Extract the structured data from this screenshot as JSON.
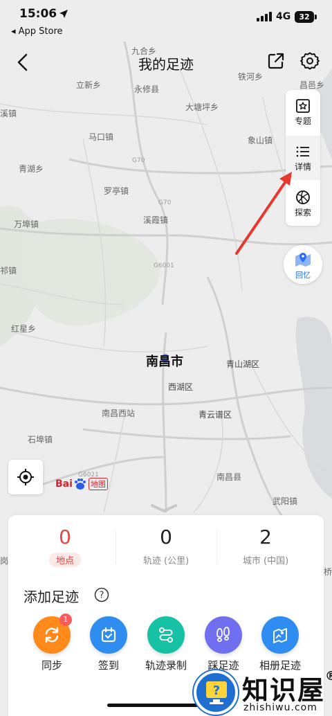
{
  "status_bar": {
    "time": "15:06",
    "back_app": "◂ App Store",
    "network": "4G",
    "battery": "32"
  },
  "nav": {
    "title": "我的足迹"
  },
  "sidebar": {
    "items": [
      {
        "label": "专题",
        "icon": "topic-icon"
      },
      {
        "label": "详情",
        "icon": "list-icon"
      },
      {
        "label": "探索",
        "icon": "explore-icon"
      }
    ]
  },
  "memory_button": {
    "label": "回忆"
  },
  "map": {
    "city": "南昌市",
    "labels": [
      "九合乡",
      "立新乡",
      "永修县",
      "铁河乡",
      "昌邑乡",
      "溪镇",
      "大塘坪乡",
      "马口镇",
      "象山镇",
      "青湖乡",
      "G70",
      "罗亭镇",
      "G70",
      "万埠镇",
      "溪霞镇",
      "G6001",
      "祁镇",
      "红星乡",
      "青山湖区",
      "西湖区",
      "南昌西站",
      "青云谱区",
      "石埠镇",
      "G6021",
      "南昌县",
      "武阳镇",
      "岗",
      "桥"
    ],
    "brand_text": "Bai",
    "brand_suffix": "地图"
  },
  "stats": [
    {
      "value": "0",
      "label": "地点"
    },
    {
      "value": "0",
      "label": "轨迹 (公里)"
    },
    {
      "value": "2",
      "label": "城市 (中国)"
    }
  ],
  "add_section": {
    "title": "添加足迹",
    "help_glyph": "?"
  },
  "actions": [
    {
      "label": "同步",
      "badge": "1",
      "color": "#ff8a1c",
      "icon": "sync-icon"
    },
    {
      "label": "签到",
      "color": "#2f8cf0",
      "icon": "checkin-icon"
    },
    {
      "label": "轨迹录制",
      "color": "#16c2a3",
      "icon": "track-record-icon"
    },
    {
      "label": "踩足迹",
      "color": "#6f6ff0",
      "icon": "footprint-icon"
    },
    {
      "label": "相册足迹",
      "color": "#2f8cf0",
      "icon": "album-icon"
    }
  ],
  "watermark": {
    "text": "知识屋",
    "reg": "®",
    "sub": "zhishiwu.com"
  }
}
